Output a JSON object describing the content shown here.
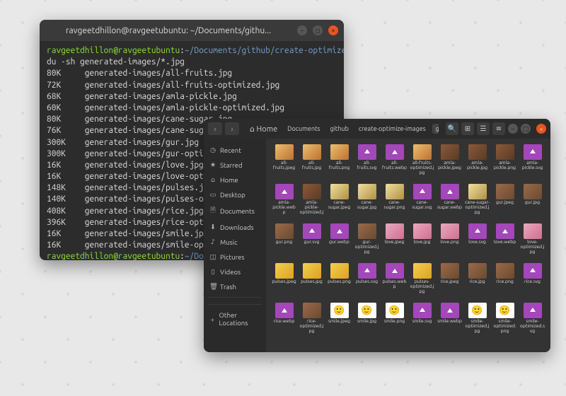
{
  "terminal": {
    "title": "ravgeetdhillon@ravgeetubuntu: ~/Documents/githu...",
    "prompt": {
      "user": "ravgeetdhillon",
      "host": "ravgeetubuntu",
      "sep": "@",
      "colon": ":",
      "path_full": "~/Documents/github/create-optimize-images",
      "path_trunc": "~/Documents/github/crea",
      "dollar": "$"
    },
    "command": "du -sh generated-images/*.jpg",
    "rows": [
      {
        "size": "80K",
        "path": "generated-images/all-fruits.jpg"
      },
      {
        "size": "72K",
        "path": "generated-images/all-fruits-optimized.jpg"
      },
      {
        "size": "68K",
        "path": "generated-images/amla-pickle.jpg"
      },
      {
        "size": "60K",
        "path": "generated-images/amla-pickle-optimized.jpg"
      },
      {
        "size": "80K",
        "path": "generated-images/cane-sugar.jpg"
      },
      {
        "size": "76K",
        "path": "generated-images/cane-sugar-optimized.jpg"
      },
      {
        "size": "300K",
        "path": "generated-images/gur.jpg"
      },
      {
        "size": "300K",
        "path": "generated-images/gur-optimized.jpg"
      },
      {
        "size": "16K",
        "path": "generated-images/love.jpg"
      },
      {
        "size": "16K",
        "path": "generated-images/love-optimized.jpg"
      },
      {
        "size": "148K",
        "path": "generated-images/pulses.jpg"
      },
      {
        "size": "140K",
        "path": "generated-images/pulses-optimized.jpg"
      },
      {
        "size": "408K",
        "path": "generated-images/rice.jpg"
      },
      {
        "size": "396K",
        "path": "generated-images/rice-optimized.jpg"
      },
      {
        "size": "16K",
        "path": "generated-images/smile.jpg"
      },
      {
        "size": "16K",
        "path": "generated-images/smile-optimized.jpg"
      }
    ]
  },
  "files": {
    "breadcrumbs": [
      "Home",
      "Documents",
      "github",
      "create-optimize-images",
      "generated-images"
    ],
    "sidebar": [
      {
        "icon": "◷",
        "label": "Recent"
      },
      {
        "icon": "★",
        "label": "Starred"
      },
      {
        "icon": "⌂",
        "label": "Home"
      },
      {
        "icon": "▭",
        "label": "Desktop"
      },
      {
        "icon": "🗎",
        "label": "Documents"
      },
      {
        "icon": "⬇",
        "label": "Downloads"
      },
      {
        "icon": "♪",
        "label": "Music"
      },
      {
        "icon": "◫",
        "label": "Pictures"
      },
      {
        "icon": "▯",
        "label": "Videos"
      },
      {
        "icon": "🗑",
        "label": "Trash"
      },
      {
        "icon": "+",
        "label": "Other Locations"
      }
    ],
    "items": [
      {
        "name": "all-fruits.jpeg",
        "t": "img-a"
      },
      {
        "name": "all-fruits.jpg",
        "t": "img-a"
      },
      {
        "name": "all-fruits.png",
        "t": "img-a"
      },
      {
        "name": "all-fruits.svg",
        "t": "svg"
      },
      {
        "name": "all-fruits.webp",
        "t": "webp"
      },
      {
        "name": "all-fruits-optimized.jpg",
        "t": "img-a"
      },
      {
        "name": "amla-pickle.jpeg",
        "t": "img-c"
      },
      {
        "name": "amla-pickle.jpg",
        "t": "img-c"
      },
      {
        "name": "amla-pickle.png",
        "t": "img-c"
      },
      {
        "name": "amla-pickle.svg",
        "t": "svg"
      },
      {
        "name": "amla-pickle.webp",
        "t": "webp"
      },
      {
        "name": "amla-pickle-optimized.jpg",
        "t": "img-c"
      },
      {
        "name": "cane-sugar.jpeg",
        "t": "img-b"
      },
      {
        "name": "cane-sugar.jpg",
        "t": "img-b"
      },
      {
        "name": "cane-sugar.png",
        "t": "img-b"
      },
      {
        "name": "cane-sugar.svg",
        "t": "svg"
      },
      {
        "name": "cane-sugar.webp",
        "t": "webp"
      },
      {
        "name": "cane-sugar-optimized.jpg",
        "t": "img-b"
      },
      {
        "name": "gur.jpeg",
        "t": "img-f"
      },
      {
        "name": "gur.jpg",
        "t": "img-f"
      },
      {
        "name": "gur.png",
        "t": "img-f"
      },
      {
        "name": "gur.svg",
        "t": "svg"
      },
      {
        "name": "gur.webp",
        "t": "webp"
      },
      {
        "name": "gur-optimized.jpg",
        "t": "img-f"
      },
      {
        "name": "love.jpeg",
        "t": "img-d"
      },
      {
        "name": "love.jpg",
        "t": "img-d"
      },
      {
        "name": "love.png",
        "t": "img-d"
      },
      {
        "name": "love.svg",
        "t": "svg"
      },
      {
        "name": "love.webp",
        "t": "webp"
      },
      {
        "name": "love-optimized.jpg",
        "t": "img-d"
      },
      {
        "name": "pulses.jpeg",
        "t": "img-e"
      },
      {
        "name": "pulses.jpg",
        "t": "img-e"
      },
      {
        "name": "pulses.png",
        "t": "img-e"
      },
      {
        "name": "pulses.svg",
        "t": "svg"
      },
      {
        "name": "pulses.webp",
        "t": "webp"
      },
      {
        "name": "pulses-optimized.jpg",
        "t": "img-e"
      },
      {
        "name": "rice.jpeg",
        "t": "img-f"
      },
      {
        "name": "rice.jpg",
        "t": "img-f"
      },
      {
        "name": "rice.png",
        "t": "img-f"
      },
      {
        "name": "rice.svg",
        "t": "svg"
      },
      {
        "name": "rice.webp",
        "t": "webp"
      },
      {
        "name": "rice-optimized.jpg",
        "t": "img-f"
      },
      {
        "name": "smile.jpeg",
        "t": "img-g"
      },
      {
        "name": "smile.jpg",
        "t": "img-g"
      },
      {
        "name": "smile.png",
        "t": "img-g"
      },
      {
        "name": "smile.svg",
        "t": "svg"
      },
      {
        "name": "smile.webp",
        "t": "webp"
      },
      {
        "name": "smile-optimized.jpg",
        "t": "img-g"
      },
      {
        "name": "smile-optimized.png",
        "t": "img-g"
      },
      {
        "name": "smile-optimized.svg",
        "t": "svg"
      }
    ]
  }
}
